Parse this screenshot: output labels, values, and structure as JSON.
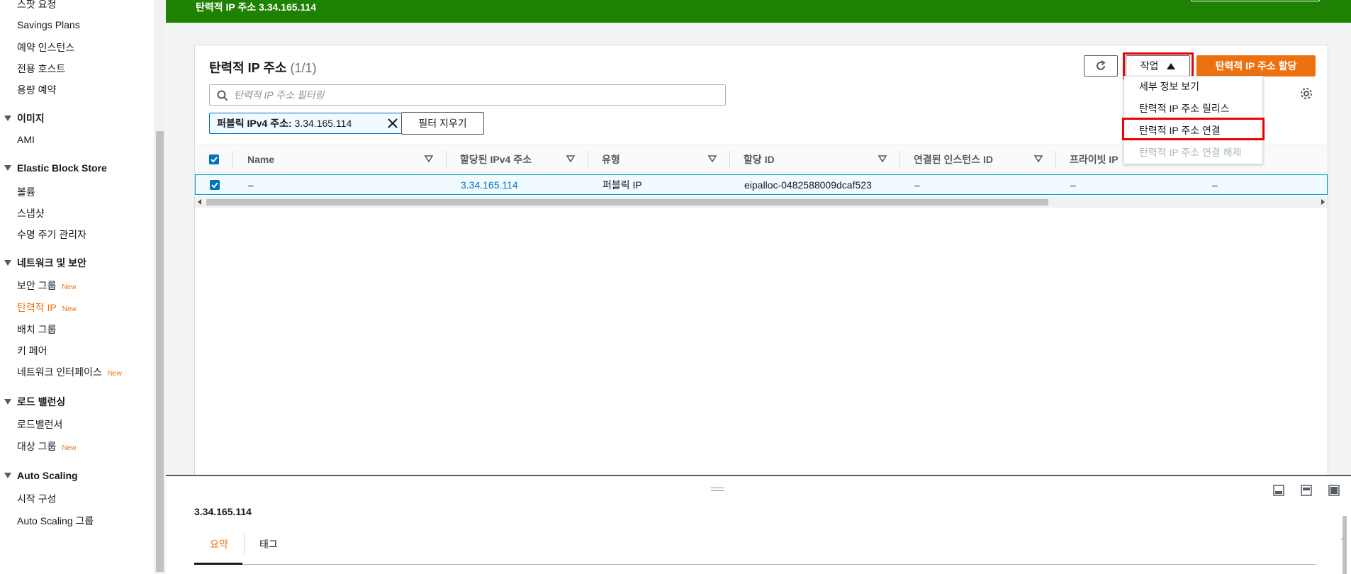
{
  "sidebar": {
    "items_top": [
      {
        "label": "스팟 요청"
      },
      {
        "label": "Savings Plans"
      },
      {
        "label": "예약 인스턴스"
      },
      {
        "label": "전용 호스트"
      },
      {
        "label": "용량 예약"
      }
    ],
    "sections": [
      {
        "title": "이미지",
        "items": [
          {
            "label": "AMI"
          }
        ]
      },
      {
        "title": "Elastic Block Store",
        "items": [
          {
            "label": "볼륨"
          },
          {
            "label": "스냅샷"
          },
          {
            "label": "수명 주기 관리자"
          }
        ]
      },
      {
        "title": "네트워크 및 보안",
        "items": [
          {
            "label": "보안 그룹",
            "badge": "New"
          },
          {
            "label": "탄력적 IP",
            "badge": "New"
          },
          {
            "label": "배치 그룹"
          },
          {
            "label": "키 페어"
          },
          {
            "label": "네트워크 인터페이스",
            "badge": "New"
          }
        ]
      },
      {
        "title": "로드 밸런싱",
        "items": [
          {
            "label": "로드밸런서"
          },
          {
            "label": "대상 그룹",
            "badge": "New"
          }
        ]
      },
      {
        "title": "Auto Scaling",
        "items": [
          {
            "label": "시작 구성"
          },
          {
            "label": "Auto Scaling 그룹"
          }
        ]
      }
    ]
  },
  "banner": {
    "text": "탄력적 IP 주소 3.34.165.114"
  },
  "panel": {
    "title": "탄력적 IP 주소",
    "count": "(1/1)",
    "actions_label": "작업",
    "allocate_label": "탄력적 IP 주소 할당",
    "search_placeholder": "탄력적 IP 주소 필터링",
    "filter_chip": {
      "key": "퍼블릭 IPv4 주소:",
      "value": "3.34.165.114"
    },
    "clear_filters_label": "필터 지우기"
  },
  "table": {
    "columns": [
      "Name",
      "할당된 IPv4 주소",
      "유형",
      "할당 ID",
      "연결된 인스턴스 ID",
      "프라이빗 IP"
    ],
    "rows": [
      {
        "name": "–",
        "ipv4": "3.34.165.114",
        "type": "퍼블릭 IP",
        "allocation_id": "eipalloc-0482588009dcaf523",
        "instance_id": "–",
        "private_ip": "–",
        "extra": "–"
      }
    ]
  },
  "dropdown": {
    "items": [
      {
        "label": "세부 정보 보기",
        "disabled": false
      },
      {
        "label": "탄력적 IP 주소 릴리스",
        "disabled": false
      },
      {
        "label": "탄력적 IP 주소 연결",
        "disabled": false
      },
      {
        "label": "탄력적 IP 주소 연결 해제",
        "disabled": true
      }
    ]
  },
  "details": {
    "ip": "3.34.165.114",
    "tabs": [
      {
        "label": "요약"
      },
      {
        "label": "태그"
      }
    ]
  },
  "colors": {
    "banner_green": "#1d8102",
    "accent_orange": "#ec7211",
    "link_blue": "#0073bb",
    "highlight_red": "#e00000"
  }
}
